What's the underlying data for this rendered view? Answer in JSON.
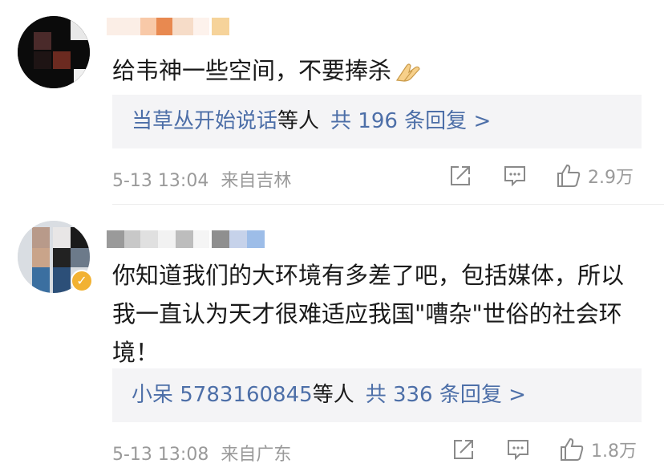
{
  "comments": [
    {
      "content": "给韦神一些空间，不要捧杀",
      "emoji_icon": "folded-hands-emoji",
      "reply": {
        "names": "当草丛开始说话",
        "deng": "等人",
        "count": "共 196 条回复 >"
      },
      "time": "5-13 13:04",
      "location": "来自吉林",
      "like_count": "2.9万"
    },
    {
      "content": "你知道我们的大环境有多差了吧，包括媒体，所以我一直认为天才很难适应我国\"嘈杂\"世俗的社会环境！",
      "reply": {
        "names": "小呆 5783160845",
        "deng": "等人",
        "count": "共 336 条回复 >"
      },
      "time": "5-13 13:08",
      "location": "来自广东",
      "like_count": "1.8万",
      "badge_color": "#f2b233"
    }
  ],
  "icons": [
    "share-icon",
    "comment-icon",
    "like-icon"
  ],
  "colors": {
    "link": "#4d6fa8",
    "meta": "#9a9a9a",
    "reply_bg": "#f4f4f6"
  }
}
